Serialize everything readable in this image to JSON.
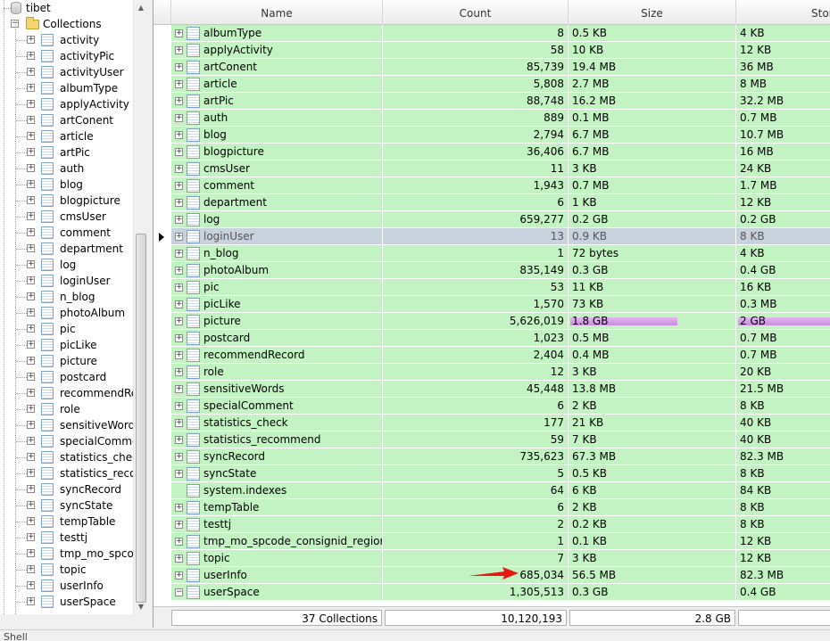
{
  "tree": {
    "db_name": "tibet",
    "collections_label": "Collections",
    "items": [
      "activity",
      "activityPic",
      "activityUser",
      "albumType",
      "applyActivity",
      "artConent",
      "article",
      "artPic",
      "auth",
      "blog",
      "blogpicture",
      "cmsUser",
      "comment",
      "department",
      "log",
      "loginUser",
      "n_blog",
      "photoAlbum",
      "pic",
      "picLike",
      "picture",
      "postcard",
      "recommendRecord",
      "role",
      "sensitiveWords",
      "specialComment",
      "statistics_check",
      "statistics_recommend",
      "syncRecord",
      "syncState",
      "tempTable",
      "testtj",
      "tmp_mo_spcode",
      "topic",
      "userInfo",
      "userSpace"
    ]
  },
  "grid": {
    "columns": [
      "Name",
      "Count",
      "Size",
      "Stor"
    ],
    "rows": [
      {
        "name": "albumType",
        "count": "8",
        "size": "0.5 KB",
        "storage": "4 KB"
      },
      {
        "name": "applyActivity",
        "count": "58",
        "size": "10 KB",
        "storage": "12 KB"
      },
      {
        "name": "artConent",
        "count": "85,739",
        "size": "19.4 MB",
        "storage": "36 MB"
      },
      {
        "name": "article",
        "count": "5,808",
        "size": "2.7 MB",
        "storage": "8 MB"
      },
      {
        "name": "artPic",
        "count": "88,748",
        "size": "16.2 MB",
        "storage": "32.2 MB"
      },
      {
        "name": "auth",
        "count": "889",
        "size": "0.1 MB",
        "storage": "0.7 MB"
      },
      {
        "name": "blog",
        "count": "2,794",
        "size": "6.7 MB",
        "storage": "10.7 MB"
      },
      {
        "name": "blogpicture",
        "count": "36,406",
        "size": "6.7 MB",
        "storage": "16 MB"
      },
      {
        "name": "cmsUser",
        "count": "11",
        "size": "3 KB",
        "storage": "24 KB"
      },
      {
        "name": "comment",
        "count": "1,943",
        "size": "0.7 MB",
        "storage": "1.7 MB"
      },
      {
        "name": "department",
        "count": "6",
        "size": "1 KB",
        "storage": "12 KB"
      },
      {
        "name": "log",
        "count": "659,277",
        "size": "0.2 GB",
        "storage": "0.2 GB"
      },
      {
        "name": "loginUser",
        "count": "13",
        "size": "0.9 KB",
        "storage": "8 KB"
      },
      {
        "name": "n_blog",
        "count": "1",
        "size": "72 bytes",
        "storage": "4 KB"
      },
      {
        "name": "photoAlbum",
        "count": "835,149",
        "size": "0.3 GB",
        "storage": "0.4 GB"
      },
      {
        "name": "pic",
        "count": "53",
        "size": "11 KB",
        "storage": "16 KB"
      },
      {
        "name": "picLike",
        "count": "1,570",
        "size": "73 KB",
        "storage": "0.3 MB"
      },
      {
        "name": "picture",
        "count": "5,626,019",
        "size": "1.8 GB",
        "storage": "2 GB"
      },
      {
        "name": "postcard",
        "count": "1,023",
        "size": "0.5 MB",
        "storage": "0.7 MB"
      },
      {
        "name": "recommendRecord",
        "count": "2,404",
        "size": "0.4 MB",
        "storage": "0.7 MB"
      },
      {
        "name": "role",
        "count": "12",
        "size": "3 KB",
        "storage": "20 KB"
      },
      {
        "name": "sensitiveWords",
        "count": "45,448",
        "size": "13.8 MB",
        "storage": "21.5 MB"
      },
      {
        "name": "specialComment",
        "count": "6",
        "size": "2 KB",
        "storage": "8 KB"
      },
      {
        "name": "statistics_check",
        "count": "177",
        "size": "21 KB",
        "storage": "40 KB"
      },
      {
        "name": "statistics_recommend",
        "count": "59",
        "size": "7 KB",
        "storage": "40 KB"
      },
      {
        "name": "syncRecord",
        "count": "735,623",
        "size": "67.3 MB",
        "storage": "82.3 MB"
      },
      {
        "name": "syncState",
        "count": "5",
        "size": "0.5 KB",
        "storage": "8 KB"
      },
      {
        "name": "system.indexes",
        "count": "64",
        "size": "6 KB",
        "storage": "84 KB"
      },
      {
        "name": "tempTable",
        "count": "6",
        "size": "2 KB",
        "storage": "8 KB"
      },
      {
        "name": "testtj",
        "count": "2",
        "size": "0.2 KB",
        "storage": "8 KB"
      },
      {
        "name": "tmp_mo_spcode_consignid_region…",
        "count": "1",
        "size": "0.1 KB",
        "storage": "12 KB"
      },
      {
        "name": "topic",
        "count": "7",
        "size": "3 KB",
        "storage": "12 KB"
      },
      {
        "name": "userInfo",
        "count": "685,034",
        "size": "56.5 MB",
        "storage": "82.3 MB"
      },
      {
        "name": "userSpace",
        "count": "1,305,513",
        "size": "0.3 GB",
        "storage": "0.4 GB"
      }
    ],
    "selected_index": 12,
    "bar_index": 17,
    "no_expander_index": 27,
    "expanded_index": 33
  },
  "footer": {
    "collections": "37 Collections",
    "count_total": "10,120,193",
    "size_total": "2.8 GB"
  },
  "status": {
    "text": "Shell"
  },
  "colors": {
    "row_bg": "#c3f2c3",
    "selected_bg": "#c8d1de",
    "bar": "#d49ee8",
    "annotation_arrow": "#e8170f"
  }
}
